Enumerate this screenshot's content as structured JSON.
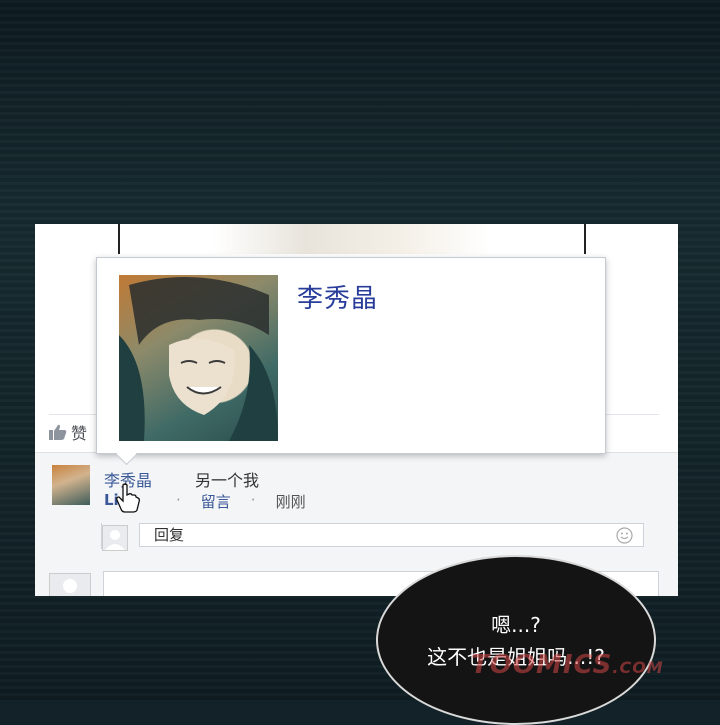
{
  "post": {
    "like_label": "赞"
  },
  "profile_popup": {
    "name": "李秀晶"
  },
  "comment": {
    "author": "李秀晶",
    "text": "另一个我",
    "like_link": "Li",
    "reply_link": "留言",
    "time": "刚刚",
    "dot": "·"
  },
  "reply_box": {
    "value": "回复"
  },
  "speech_bubble": {
    "line1": "嗯...?",
    "line2": "这不也是姐姐吗...!?"
  },
  "watermark": {
    "text": "TOOMICS",
    "suffix": ".COM"
  },
  "icons": {
    "like": "thumbs-up-icon",
    "emoji": "smiley-icon",
    "cursor": "hand-pointer-icon"
  },
  "colors": {
    "link": "#3b5998",
    "popup_name": "#283c9a",
    "background": "#122228"
  }
}
